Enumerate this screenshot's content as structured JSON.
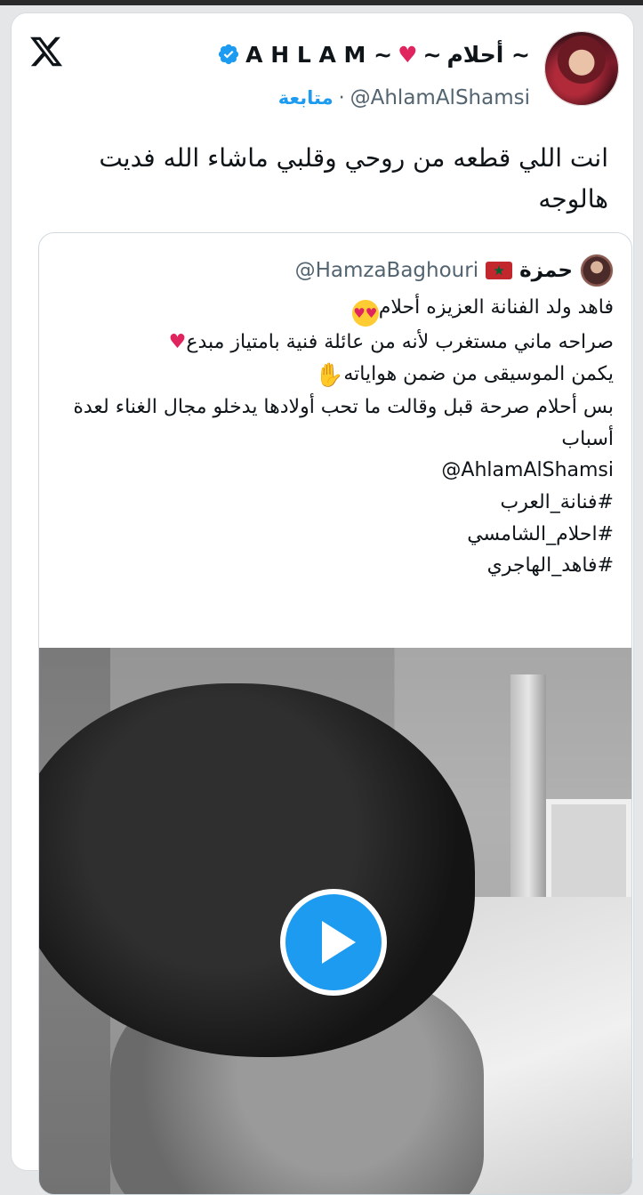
{
  "platform": {
    "logo_icon": "x-logo-icon"
  },
  "author": {
    "display_name": "A H L A M ~",
    "display_name_ar": "أحلام ~",
    "heart": "♥",
    "tilde": "~",
    "handle": "@AhlamAlShamsi",
    "separator": "·",
    "follow_label": "متابعة",
    "verified_icon": "verified-badge-icon"
  },
  "tweet": {
    "text": "انت اللي قطعه من روحي وقلبي ماشاء الله فديت هالوجه"
  },
  "quoted": {
    "name": "حمزة",
    "handle": "@HamzaBaghouri",
    "flag_icon": "morocco-flag-icon",
    "lines": [
      "فاهد ولد الفنانة العزيزه أحلام",
      "صراحه ماني مستغرب لأنه من عائلة فنية بامتياز مبدع",
      "يكمن الموسيقى من ضمن هواياته",
      "بس أحلام صرحة قبل وقالت ما تحب أولادها يدخلو مجال الغناء لعدة أسباب",
      "@AhlamAlShamsi",
      "#فنانة_العرب",
      "#احلام_الشامسي",
      "#فاهد_الهاجري"
    ],
    "video": {
      "play_icon": "play-icon"
    }
  },
  "colors": {
    "accent": "#1d9bf0",
    "heart": "#e0245e",
    "text": "#0f1419",
    "muted": "#536471"
  }
}
